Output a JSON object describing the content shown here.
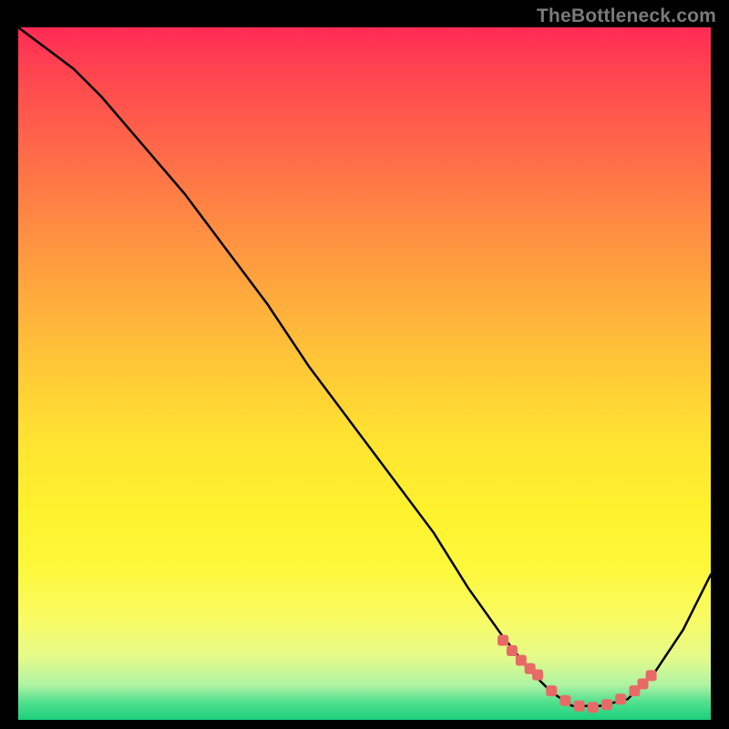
{
  "attribution": "TheBottleneck.com",
  "chart_data": {
    "type": "line",
    "title": "",
    "xlabel": "",
    "ylabel": "",
    "xlim": [
      0,
      100
    ],
    "ylim": [
      0,
      100
    ],
    "series": [
      {
        "name": "curve",
        "x": [
          0,
          4,
          8,
          12,
          18,
          24,
          30,
          36,
          42,
          48,
          54,
          60,
          65,
          70,
          74,
          77,
          80,
          84,
          88,
          92,
          96,
          100
        ],
        "values": [
          100,
          97,
          94,
          90,
          83,
          76,
          68,
          60,
          51,
          43,
          35,
          27,
          19,
          12,
          7,
          4,
          2,
          2,
          3,
          7,
          13,
          21
        ]
      }
    ],
    "markers": {
      "name": "highlight-band",
      "x": [
        70.0,
        71.3,
        72.6,
        73.9,
        75.0,
        77.0,
        79.0,
        81.0,
        83.0,
        85.0,
        87.0,
        89.0,
        90.2,
        91.4
      ],
      "values": [
        11.5,
        10.0,
        8.6,
        7.4,
        6.5,
        4.2,
        2.8,
        2.0,
        1.8,
        2.2,
        3.0,
        4.2,
        5.2,
        6.4
      ]
    },
    "gradient_stops": [
      {
        "pct": 0,
        "color": "#ff2b55"
      },
      {
        "pct": 18,
        "color": "#ff6a49"
      },
      {
        "pct": 38,
        "color": "#ffa83d"
      },
      {
        "pct": 60,
        "color": "#ffe431"
      },
      {
        "pct": 78,
        "color": "#fdf83a"
      },
      {
        "pct": 95,
        "color": "#aef3a3"
      },
      {
        "pct": 100,
        "color": "#1bd07c"
      }
    ]
  }
}
